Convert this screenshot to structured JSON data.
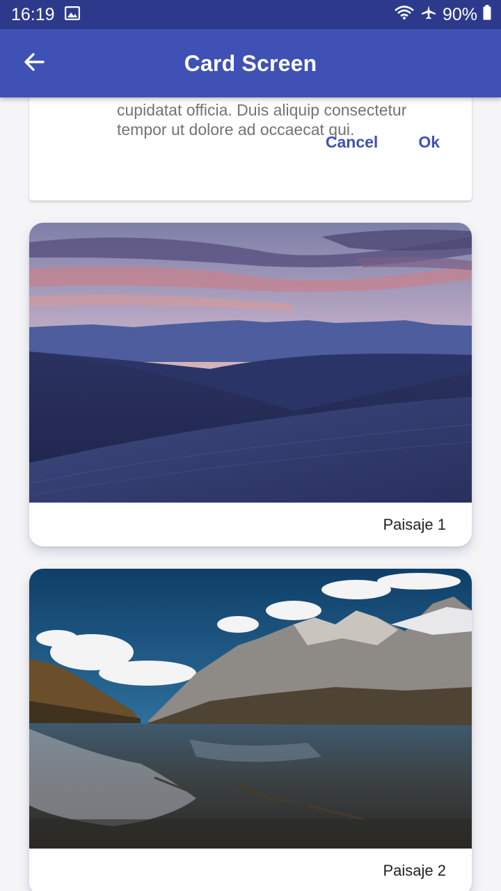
{
  "status_bar": {
    "time": "16:19",
    "battery": "90%",
    "icons": [
      "gallery-icon",
      "wifi-icon",
      "airplane-icon",
      "battery-icon"
    ]
  },
  "app_bar": {
    "title": "Card Screen",
    "back_icon": "arrow-back-icon"
  },
  "top_card": {
    "text_line_1": "cupidatat officia. Duis aliquip consectetur",
    "text_line_2": "tempor ut dolore ad occaecat qui.",
    "cancel_label": "Cancel",
    "ok_label": "Ok"
  },
  "cards": [
    {
      "caption": "Paisaje 1"
    },
    {
      "caption": "Paisaje 2"
    }
  ],
  "colors": {
    "app_bar": "#3f51b5",
    "status_bar": "#2d3a8c",
    "accent": "#3f51b5"
  }
}
